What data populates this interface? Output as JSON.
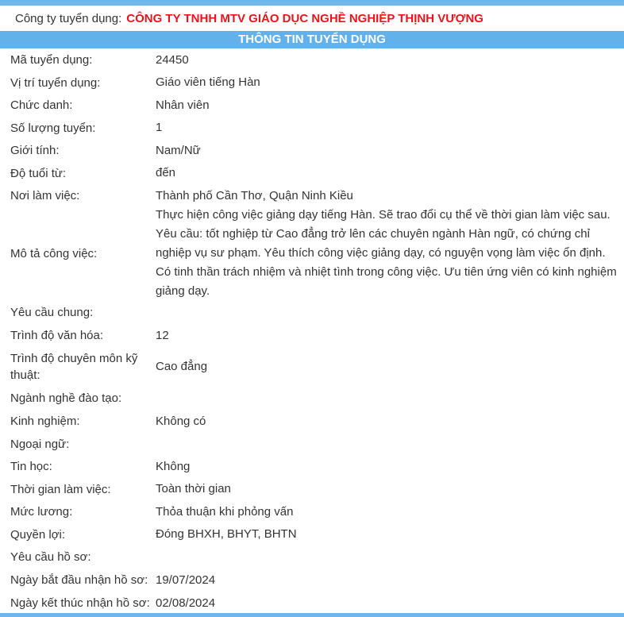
{
  "company": {
    "label": "Công ty tuyển dụng:",
    "name": "CÔNG TY TNHH MTV GIÁO DỤC NGHỀ NGHIỆP THỊNH VƯỢNG"
  },
  "section_title": "THÔNG TIN TUYỂN DỤNG",
  "fields": [
    {
      "label": "Mã tuyển dụng:",
      "value": "24450"
    },
    {
      "label": "Vị trí tuyển dụng:",
      "value": "Giáo viên tiếng Hàn"
    },
    {
      "label": "Chức danh:",
      "value": "Nhân viên"
    },
    {
      "label": "Số lượng tuyển:",
      "value": "1"
    },
    {
      "label": "Giới tính:",
      "value": "Nam/Nữ"
    },
    {
      "label": "Độ tuổi từ:",
      "value": "đến"
    },
    {
      "label": "Nơi làm việc:",
      "value": "Thành phố Cần Thơ, Quận Ninh Kiều"
    },
    {
      "label": "Mô tả công việc:",
      "value": "Thực hiện công việc giảng dạy tiếng Hàn. Sẽ trao đổi cụ thể về thời gian làm việc sau. Yêu cầu: tốt nghiệp từ Cao đẳng trở lên các chuyên ngành Hàn ngữ, có chứng chỉ nghiệp vụ sư phạm. Yêu thích công việc giảng dạy, có nguyện vọng làm việc ổn định. Có tinh thần trách nhiệm và nhiệt tình trong công việc. Ưu tiên ứng viên có kinh nghiệm giảng dạy."
    },
    {
      "label": "Yêu cầu chung:",
      "value": ""
    },
    {
      "label": "Trình độ văn hóa:",
      "value": "12"
    },
    {
      "label": "Trình độ chuyên môn kỹ thuật:",
      "value": "Cao đẳng"
    },
    {
      "label": "Ngành nghề đào tạo:",
      "value": ""
    },
    {
      "label": "Kinh nghiệm:",
      "value": "Không có"
    },
    {
      "label": "Ngoại ngữ:",
      "value": ""
    },
    {
      "label": "Tin học:",
      "value": "Không"
    },
    {
      "label": "Thời gian làm việc:",
      "value": "Toàn thời gian"
    },
    {
      "label": "Mức lương:",
      "value": "Thỏa thuận khi phỏng vấn"
    },
    {
      "label": "Quyền lợi:",
      "value": "Đóng BHXH, BHYT, BHTN"
    },
    {
      "label": "Yêu cầu hồ sơ:",
      "value": ""
    },
    {
      "label": "Ngày bắt đầu nhận hồ sơ:",
      "value": "19/07/2024"
    },
    {
      "label": "Ngày kết thúc nhận hồ sơ:",
      "value": "02/08/2024"
    }
  ]
}
